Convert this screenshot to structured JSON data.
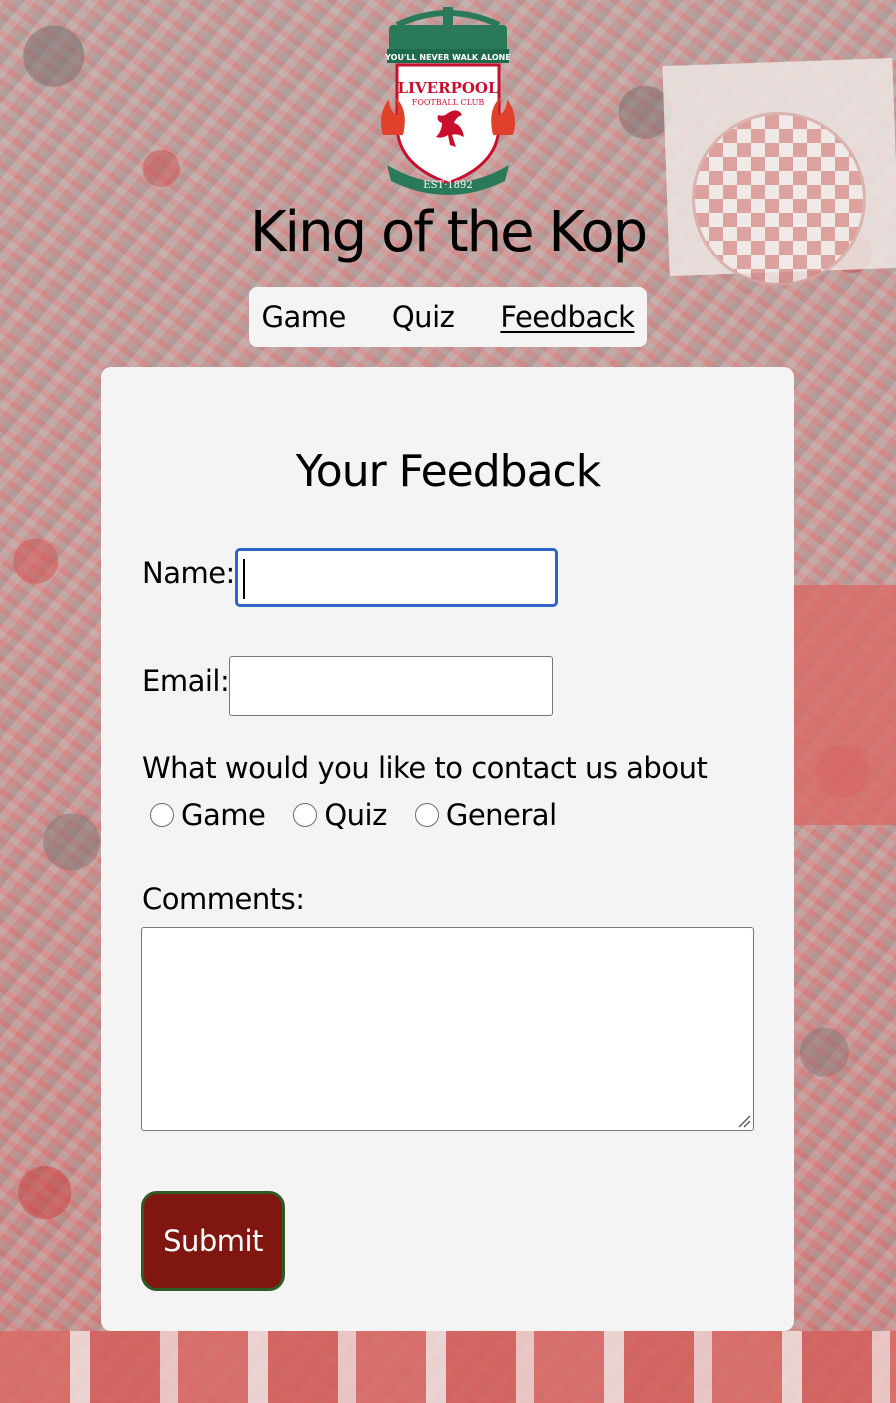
{
  "site": {
    "title": "King of the Kop",
    "crest_text_top": "YOU'LL NEVER WALK ALONE",
    "crest_text_name": "LIVERPOOL",
    "crest_text_club": "FOOTBALL CLUB",
    "crest_text_est": "EST·1892"
  },
  "nav": {
    "items": [
      {
        "label": "Game",
        "active": false
      },
      {
        "label": "Quiz",
        "active": false
      },
      {
        "label": "Feedback",
        "active": true
      }
    ]
  },
  "form": {
    "title": "Your Feedback",
    "name_label": "Name:",
    "name_value": "",
    "email_label": "Email:",
    "email_value": "",
    "topic_question": "What would you like to contact us about",
    "topics": [
      "Game",
      "Quiz",
      "General"
    ],
    "comments_label": "Comments:",
    "comments_value": "",
    "submit_label": "Submit"
  },
  "colors": {
    "submit_bg": "#7f1710",
    "submit_border": "#2f5a26",
    "focus_ring": "#2f64c6",
    "card_bg": "#f4f4f4"
  }
}
